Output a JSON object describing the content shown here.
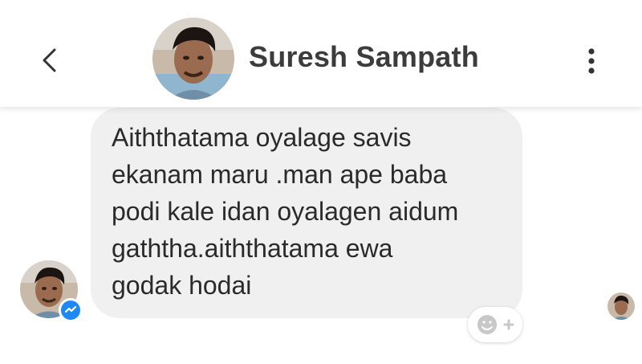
{
  "header": {
    "contact_name": "Suresh Sampath",
    "back_icon": "chevron-left-icon",
    "more_icon": "vertical-dots-icon"
  },
  "conversation": {
    "messages": [
      {
        "sender": "Suresh Sampath",
        "direction": "incoming",
        "text": "Aiththatama oyalage savis\nekanam maru   .man ape baba\npodi kale idan oyalagen aidum\ngaththa.aiththatama ewa\ngodak hodai"
      }
    ],
    "reaction_button_icon": "add-reaction-smiley-icon",
    "platform_badge_icon": "messenger-icon"
  },
  "colors": {
    "bubble_bg": "#f0f0f0",
    "text": "#2a2a2a",
    "messenger_blue": "#1e88f5"
  }
}
